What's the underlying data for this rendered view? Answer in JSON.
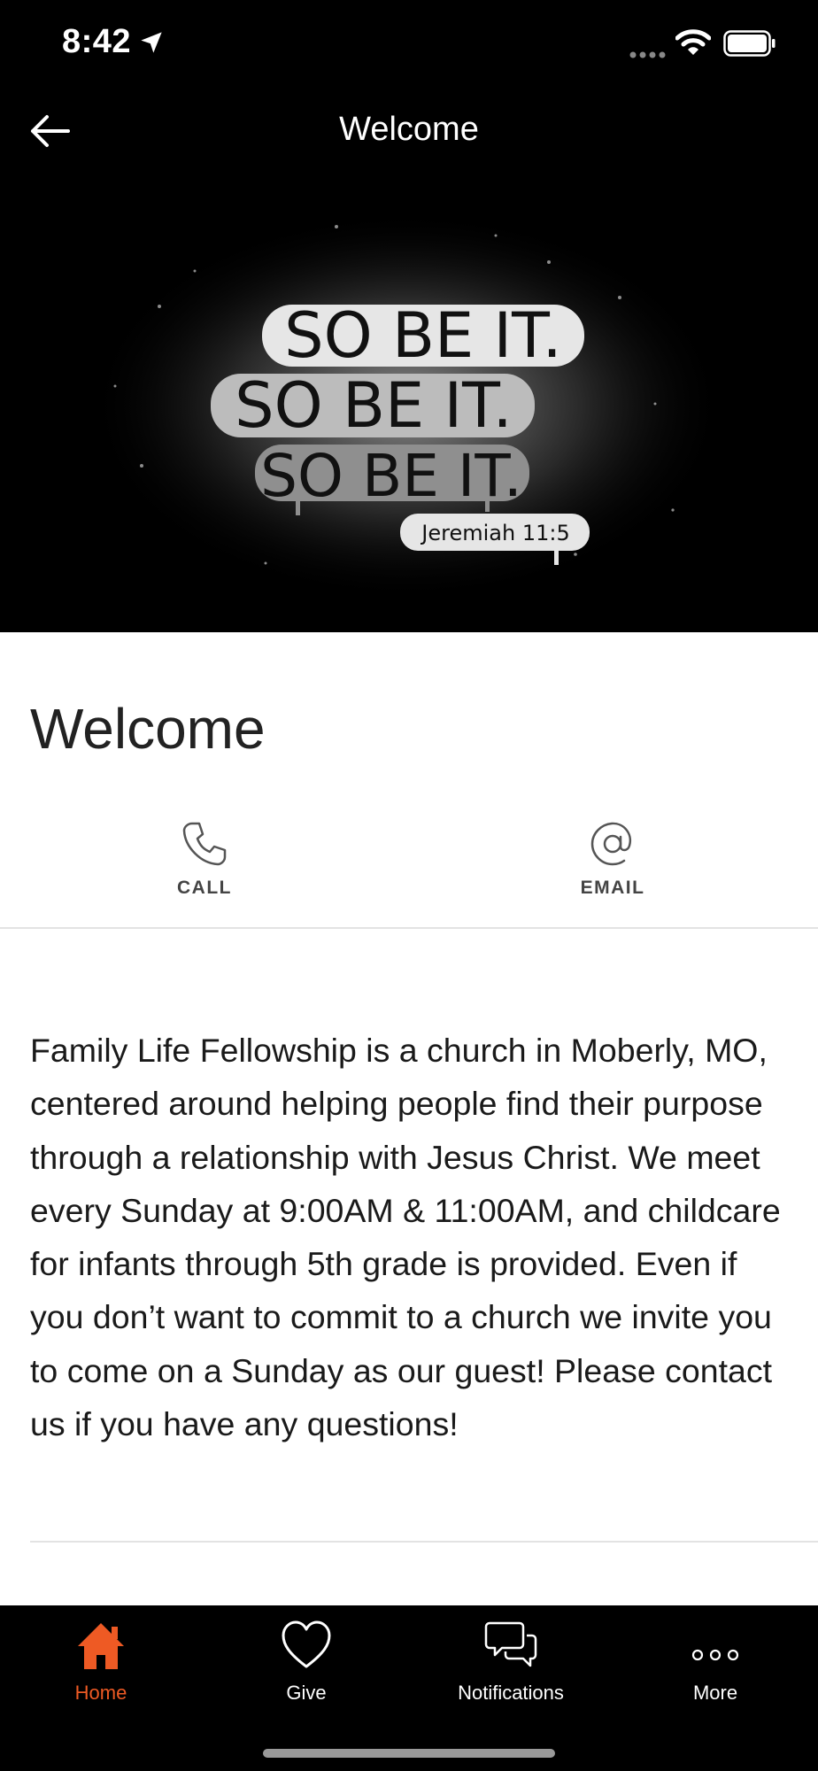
{
  "status_bar": {
    "time": "8:42"
  },
  "nav": {
    "title": "Welcome"
  },
  "hero": {
    "line1": "SO BE IT.",
    "line2": "SO BE IT.",
    "line3": "SO BE IT.",
    "reference": "Jeremiah 11:5"
  },
  "page": {
    "title": "Welcome",
    "body": "Family Life Fellowship is a church in Moberly, MO, centered around helping people find their purpose through a relationship with Jesus Christ. We meet every Sunday at 9:00AM & 11:00AM, and childcare for infants through 5th grade is provided.  Even if you don’t want to commit to a church we invite you to come on a Sunday as our guest! Please contact us if you have any questions!"
  },
  "contact": {
    "call_label": "CALL",
    "email_label": "EMAIL"
  },
  "tabs": [
    {
      "label": "Home",
      "icon": "home-icon",
      "active": true
    },
    {
      "label": "Give",
      "icon": "heart-icon",
      "active": false
    },
    {
      "label": "Notifications",
      "icon": "chat-bubbles-icon",
      "active": false
    },
    {
      "label": "More",
      "icon": "more-dots-icon",
      "active": false
    }
  ],
  "colors": {
    "accent": "#ee5a24",
    "bar_background": "#000000"
  }
}
